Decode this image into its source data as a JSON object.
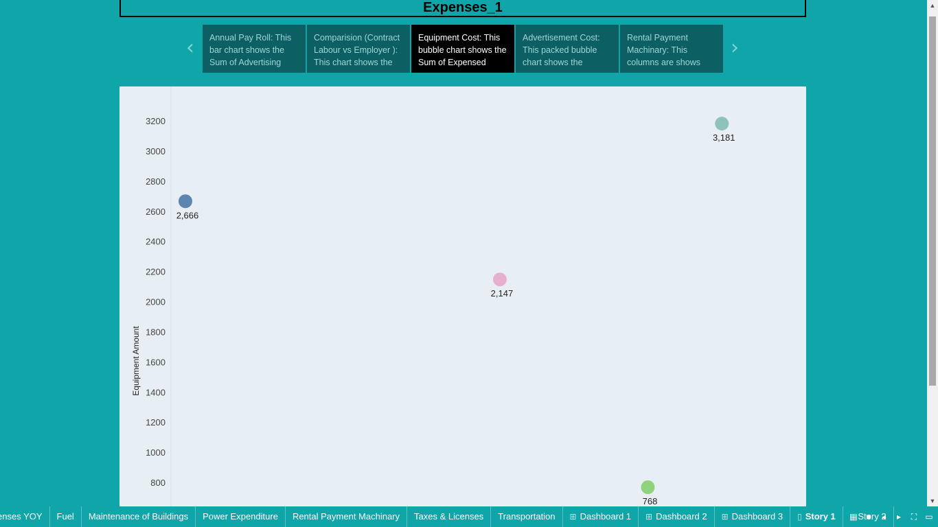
{
  "story": {
    "title": "Expenses_1",
    "points": [
      {
        "text": "Annual Pay Roll: This bar chart shows the Sum of Advertising"
      },
      {
        "text": " Comparision (Contract Labour vs Employer ): This chart shows the"
      },
      {
        "text": "Equipment Cost: This bubble chart shows the Sum of Expensed"
      },
      {
        "text": "Advertisement Cost: This packed bubble chart shows the"
      },
      {
        "text": "Rental Payment Machinary: This columns are shows"
      }
    ],
    "active_index": 2
  },
  "nav": {
    "prev_icon": "chevron-left-icon",
    "next_icon": "chevron-right-icon"
  },
  "chart_data": {
    "type": "scatter",
    "ylabel": "Equipment Amount",
    "ylim": [
      700,
      3360
    ],
    "yticks": [
      800,
      1000,
      1200,
      1400,
      1600,
      1800,
      2000,
      2200,
      2400,
      2600,
      2800,
      3000,
      3200
    ],
    "points": [
      {
        "x": 1,
        "y": 2666,
        "label": "2,666",
        "color": "#4e79a7"
      },
      {
        "x": 52,
        "y": 2147,
        "label": "2,147",
        "color": "#e4a7c9"
      },
      {
        "x": 76,
        "y": 768,
        "label": "768",
        "color": "#86cf6f"
      },
      {
        "x": 88,
        "y": 3181,
        "label": "3,181",
        "color": "#86bcb6"
      }
    ],
    "xlim": [
      0,
      100
    ]
  },
  "tabs": [
    {
      "label": "enses YOY",
      "icon": ""
    },
    {
      "label": "Fuel",
      "icon": ""
    },
    {
      "label": "Maintenance of Buildings",
      "icon": ""
    },
    {
      "label": "Power Expenditure",
      "icon": ""
    },
    {
      "label": "Rental Payment Machinary",
      "icon": ""
    },
    {
      "label": "Taxes & Licenses",
      "icon": ""
    },
    {
      "label": "Transportation",
      "icon": ""
    },
    {
      "label": "Dashboard 1",
      "icon": "dashboard-icon"
    },
    {
      "label": "Dashboard 2",
      "icon": "dashboard-icon"
    },
    {
      "label": "Dashboard 3",
      "icon": "dashboard-icon"
    },
    {
      "label": "Story 1",
      "icon": "story-icon",
      "active": true
    },
    {
      "label": "Story 2",
      "icon": "story-icon"
    }
  ],
  "controls": [
    "filmstrip-icon",
    "tab-view-icon",
    "prev-sheet-icon",
    "next-sheet-icon",
    "fullscreen-icon",
    "presentation-icon"
  ],
  "colors": {
    "background": "#10a5a8",
    "panel": "#e7eff5",
    "story_point": "#0c5f62",
    "story_point_active": "#000000"
  }
}
